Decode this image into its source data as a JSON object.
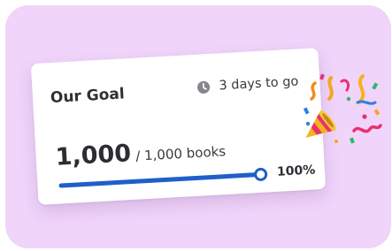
{
  "goal_card": {
    "title": "Our Goal",
    "countdown": "3 days to go",
    "current": "1,000",
    "target": "/ 1,000 books",
    "percent_label": "100%",
    "progress_fraction": 1.0
  },
  "icons": {
    "countdown": "clock-icon",
    "celebration": "party-popper-icon"
  },
  "colors": {
    "backdrop": "#f0d4fa",
    "accent": "#1f5fc9",
    "track": "#d9e3f4"
  }
}
